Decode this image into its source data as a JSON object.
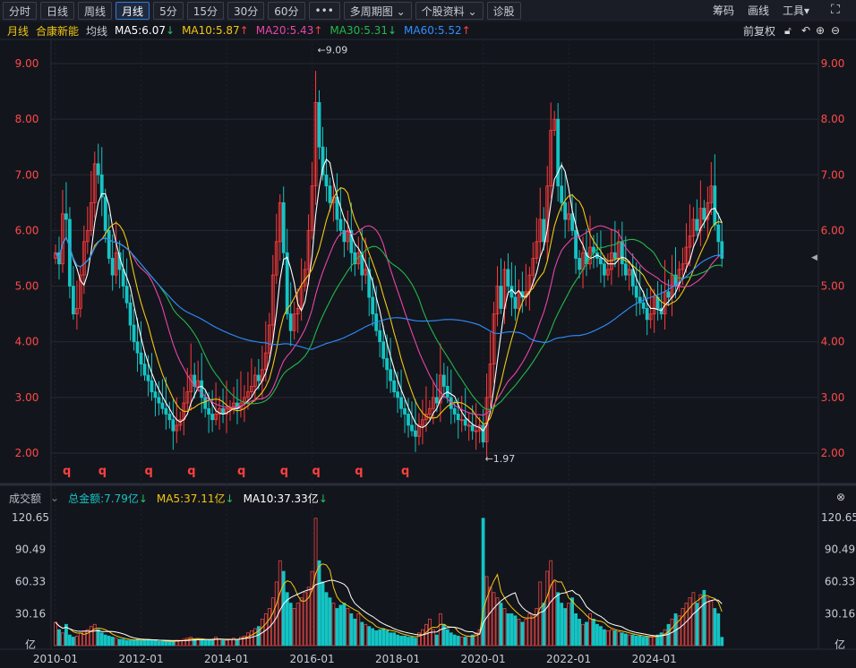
{
  "toolbar": {
    "buttons": [
      "分时",
      "日线",
      "周线",
      "月线",
      "5分",
      "15分",
      "30分",
      "60分",
      "•••",
      "多周期图 ⌄",
      "个股资料 ⌄",
      "诊股"
    ],
    "active": "月线",
    "right": [
      "筹码",
      "画线",
      "工具▾"
    ]
  },
  "legend": {
    "period": "月线",
    "stock": "合康新能",
    "ma_label": "均线",
    "ma5": "MA5:6.07",
    "ma10": "MA10:5.87",
    "ma20": "MA20:5.43",
    "ma30": "MA30:5.31",
    "ma60": "MA60:5.52",
    "adjust": "前复权"
  },
  "colors": {
    "bg": "#13151c",
    "up": "#ff3b3b",
    "down": "#14c4c4",
    "ma5": "#ffffff",
    "ma10": "#f2c811",
    "ma20": "#e845a8",
    "ma30": "#23b84a",
    "ma60": "#2f8fff",
    "grid": "#262a35"
  },
  "volume_header": {
    "label": "成交额",
    "total": "总金额:7.79亿",
    "ma5": "MA5:37.11亿",
    "ma10": "MA10:37.33亿"
  },
  "chart_data": {
    "type": "candlestick",
    "start": "2010-01",
    "period": "monthly",
    "price_ticks": [
      "9.00",
      "8.00",
      "7.00",
      "6.00",
      "5.00",
      "4.00",
      "3.00",
      "2.00"
    ],
    "ylim": [
      1.8,
      9.3
    ],
    "annotations": [
      {
        "label": "9.09",
        "value": 9.09,
        "month": "2016-02"
      },
      {
        "label": "1.97",
        "value": 1.97,
        "month": "2020-01"
      }
    ],
    "markers": {
      "label": "q",
      "months": [
        3,
        13,
        26,
        38,
        52,
        64,
        73,
        85,
        98
      ]
    },
    "x_ticks": [
      "2010-01",
      "2012-01",
      "2014-01",
      "2016-01",
      "2018-01",
      "2020-01",
      "2022-01",
      "2024-01"
    ],
    "closes": [
      5.6,
      5.4,
      6.3,
      6.2,
      5.0,
      4.5,
      4.6,
      5.2,
      5.8,
      6.0,
      6.5,
      7.2,
      7.0,
      6.6,
      6.0,
      5.5,
      5.2,
      5.6,
      5.3,
      5.0,
      4.7,
      4.3,
      4.0,
      3.8,
      3.6,
      3.4,
      3.3,
      3.1,
      3.0,
      2.9,
      2.8,
      2.7,
      2.6,
      2.4,
      2.5,
      2.6,
      2.9,
      3.1,
      3.4,
      3.2,
      3.3,
      3.0,
      2.8,
      2.7,
      2.6,
      2.7,
      2.8,
      2.7,
      2.8,
      2.8,
      2.9,
      2.8,
      2.9,
      3.0,
      3.1,
      3.2,
      3.4,
      3.3,
      3.5,
      3.8,
      4.3,
      5.2,
      5.8,
      6.5,
      5.6,
      4.5,
      4.2,
      4.5,
      4.6,
      5.0,
      5.3,
      6.0,
      6.8,
      8.3,
      7.5,
      7.0,
      6.8,
      6.5,
      6.6,
      6.2,
      6.0,
      5.8,
      6.0,
      5.6,
      5.4,
      5.6,
      5.2,
      5.3,
      4.8,
      4.5,
      4.2,
      4.0,
      3.7,
      3.5,
      3.3,
      3.1,
      3.0,
      2.8,
      2.7,
      2.5,
      2.4,
      2.3,
      2.5,
      2.6,
      2.7,
      2.8,
      3.0,
      2.9,
      3.4,
      3.2,
      3.0,
      2.8,
      2.7,
      2.6,
      2.6,
      2.5,
      2.5,
      2.4,
      2.4,
      2.5,
      2.2,
      3.0,
      3.6,
      4.5,
      5.0,
      4.6,
      5.3,
      5.0,
      4.8,
      4.6,
      4.9,
      4.8,
      4.9,
      5.2,
      5.5,
      5.8,
      6.2,
      5.8,
      6.8,
      7.8,
      8.0,
      6.8,
      6.5,
      6.2,
      6.3,
      6.0,
      5.5,
      5.3,
      5.6,
      5.4,
      5.7,
      5.6,
      5.5,
      5.4,
      5.2,
      5.3,
      5.6,
      5.5,
      5.8,
      5.4,
      5.2,
      5.3,
      5.0,
      4.8,
      4.7,
      4.6,
      4.4,
      4.5,
      4.8,
      4.6,
      4.5,
      4.9,
      4.8,
      5.2,
      5.0,
      5.3,
      5.4,
      5.7,
      5.9,
      6.2,
      6.0,
      6.4,
      6.2,
      6.5,
      6.8,
      6.1,
      5.8,
      5.5
    ],
    "volume_ticks": [
      "120.65",
      "90.49",
      "60.33",
      "30.16",
      "亿"
    ],
    "volume_max": 120.65,
    "volumes": [
      22,
      15,
      12,
      20,
      10,
      8,
      9,
      12,
      14,
      15,
      18,
      20,
      15,
      12,
      10,
      9,
      8,
      7,
      6,
      6,
      5,
      5,
      5,
      6,
      5,
      6,
      6,
      5,
      5,
      4,
      4,
      4,
      4,
      4,
      5,
      5,
      6,
      7,
      8,
      6,
      6,
      5,
      5,
      5,
      6,
      8,
      6,
      5,
      5,
      6,
      7,
      6,
      8,
      9,
      12,
      14,
      16,
      18,
      25,
      30,
      35,
      45,
      60,
      80,
      70,
      50,
      40,
      35,
      40,
      45,
      50,
      55,
      70,
      120,
      80,
      60,
      50,
      45,
      40,
      35,
      38,
      40,
      35,
      30,
      25,
      30,
      22,
      20,
      18,
      16,
      14,
      15,
      16,
      14,
      12,
      12,
      10,
      9,
      9,
      8,
      8,
      7,
      12,
      15,
      20,
      25,
      15,
      10,
      30,
      20,
      15,
      12,
      10,
      9,
      8,
      8,
      9,
      10,
      12,
      15,
      120,
      65,
      55,
      50,
      45,
      40,
      35,
      30,
      30,
      28,
      25,
      22,
      25,
      30,
      28,
      35,
      60,
      40,
      70,
      80,
      60,
      50,
      40,
      35,
      40,
      45,
      30,
      25,
      20,
      22,
      30,
      25,
      20,
      18,
      15,
      14,
      15,
      14,
      13,
      12,
      11,
      10,
      10,
      9,
      9,
      8,
      8,
      8,
      9,
      10,
      12,
      15,
      20,
      25,
      30,
      28,
      35,
      40,
      45,
      50,
      40,
      48,
      52,
      45,
      42,
      35,
      30,
      7.79
    ]
  }
}
